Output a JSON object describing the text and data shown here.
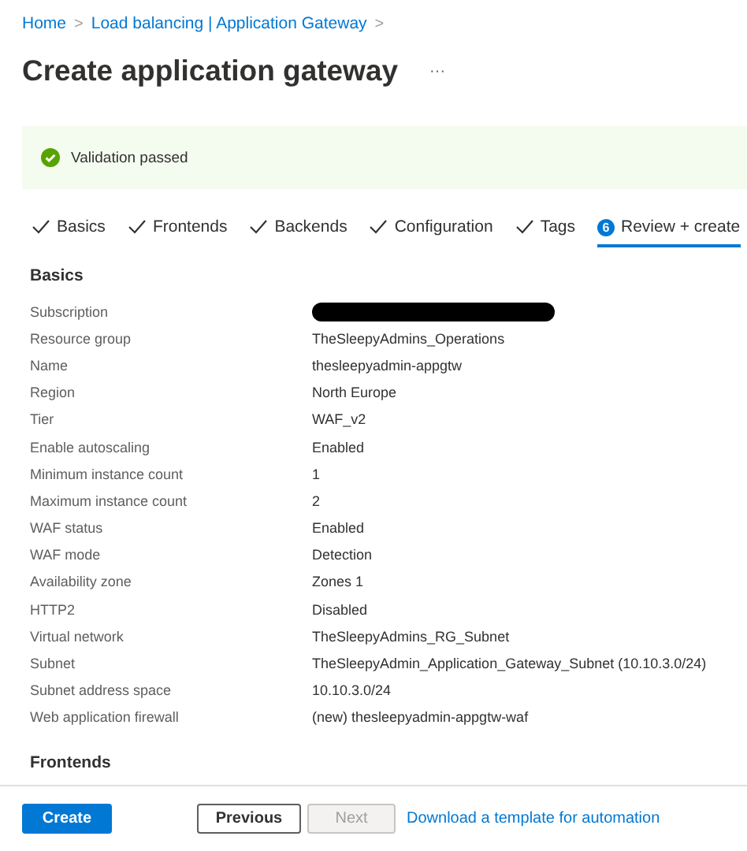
{
  "breadcrumb": [
    {
      "label": "Home",
      "separator": ">"
    },
    {
      "label": "Load balancing | Application Gateway",
      "separator": ">"
    }
  ],
  "title": "Create application gateway",
  "more": "···",
  "banner": {
    "kind": "success",
    "text": "Validation passed"
  },
  "tabs": [
    {
      "label": "Basics",
      "completed": true,
      "selected": false
    },
    {
      "label": "Frontends",
      "completed": true,
      "selected": false
    },
    {
      "label": "Backends",
      "completed": true,
      "selected": false
    },
    {
      "label": "Configuration",
      "completed": true,
      "selected": false
    },
    {
      "label": "Tags",
      "completed": true,
      "selected": false
    },
    {
      "label": "Review + create",
      "step": "6",
      "completed": false,
      "selected": true
    }
  ],
  "sections": [
    {
      "title": "Basics",
      "rows": [
        {
          "label": "Subscription",
          "redacted": true
        },
        {
          "label": "Resource group",
          "value": "TheSleepyAdmins_Operations"
        },
        {
          "label": "Name",
          "value": "thesleepyadmin-appgtw"
        },
        {
          "label": "Region",
          "value": "North Europe"
        },
        {
          "label": "Tier",
          "value": "WAF_v2"
        },
        {
          "label": "Enable autoscaling",
          "value": "Enabled"
        },
        {
          "label": "Minimum instance count",
          "value": "1"
        },
        {
          "label": "Maximum instance count",
          "value": "2"
        },
        {
          "label": "WAF status",
          "value": "Enabled"
        },
        {
          "label": "WAF mode",
          "value": "Detection"
        },
        {
          "label": "Availability zone",
          "value": "Zones 1"
        },
        {
          "label": "HTTP2",
          "value": "Disabled"
        },
        {
          "label": "Virtual network",
          "value": "TheSleepyAdmins_RG_Subnet"
        },
        {
          "label": "Subnet",
          "value": "TheSleepyAdmin_Application_Gateway_Subnet (10.10.3.0/24)"
        },
        {
          "label": "Subnet address space",
          "value": "10.10.3.0/24"
        },
        {
          "label": "Web application firewall",
          "value": "(new) thesleepyadmin-appgtw-waf"
        }
      ]
    },
    {
      "title": "Frontends"
    }
  ],
  "footer": {
    "buttons": [
      {
        "label": "Create",
        "kind": "primary",
        "disabled": false
      },
      {
        "label": "Previous",
        "kind": "secondary",
        "disabled": false
      },
      {
        "label": "Next",
        "kind": "secondary",
        "disabled": true
      }
    ],
    "link": "Download a template for automation"
  }
}
